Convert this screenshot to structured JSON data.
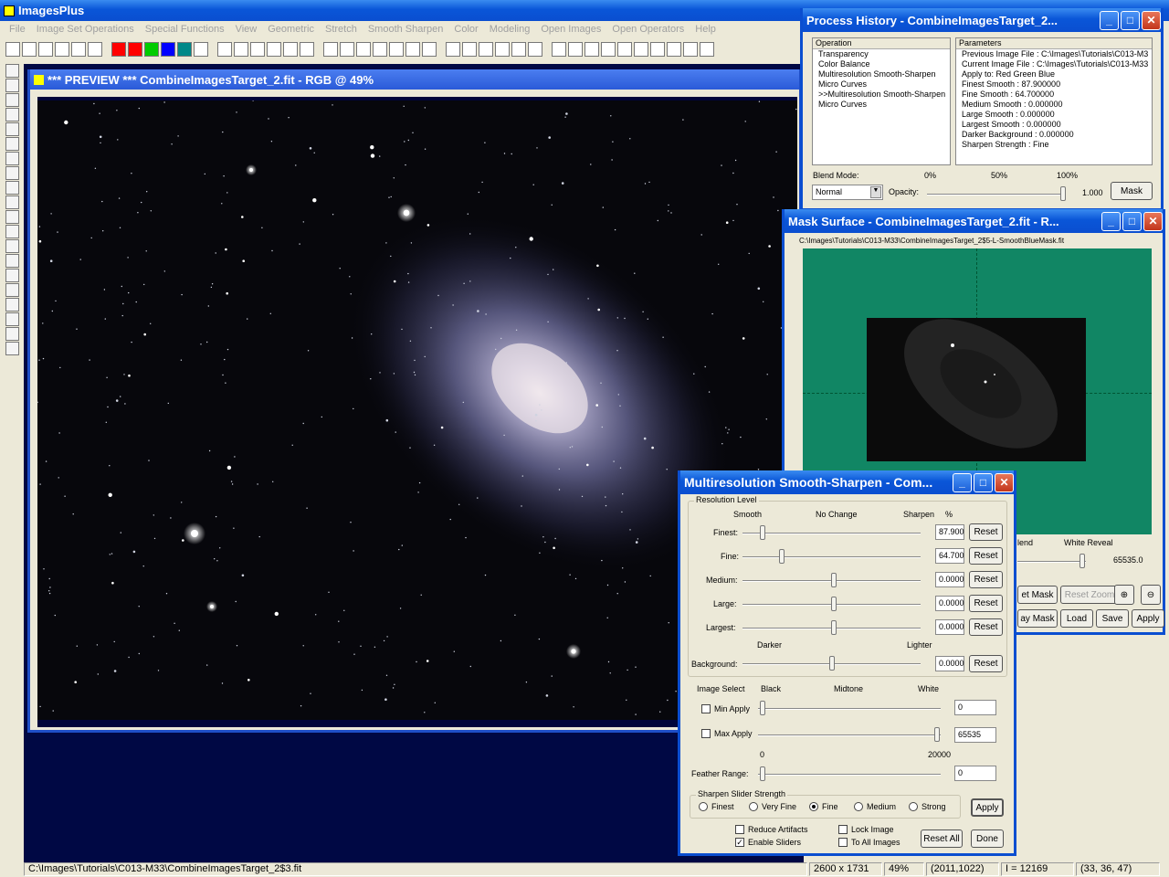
{
  "app": {
    "title": "ImagesPlus",
    "menu": [
      "File",
      "Image Set Operations",
      "Special Functions",
      "View",
      "Geometric",
      "Stretch",
      "Smooth Sharpen",
      "Color",
      "Modeling",
      "Open Images",
      "Open Operators",
      "Help"
    ]
  },
  "preview": {
    "title": "*** PREVIEW *** CombineImagesTarget_2.fit - RGB @  49%"
  },
  "history": {
    "title": "Process History - CombineImagesTarget_2...",
    "op_header": "Operation",
    "param_header": "Parameters",
    "operations": [
      "Transparency",
      "Color Balance",
      "Multiresolution Smooth-Sharpen",
      "Micro Curves",
      ">>Multiresolution Smooth-Sharpen",
      "Micro Curves"
    ],
    "parameters": [
      "Previous Image File : C:\\Images\\Tutorials\\C013-M3",
      "Current Image File : C:\\Images\\Tutorials\\C013-M33",
      "Apply to:  Red Green Blue",
      "Finest Smooth : 87.900000",
      "Fine Smooth : 64.700000",
      "Medium Smooth : 0.000000",
      "Large Smooth : 0.000000",
      "Largest Smooth : 0.000000",
      "Darker Background : 0.000000",
      "Sharpen Strength : Fine"
    ],
    "blend_label": "Blend Mode:",
    "blend_value": "Normal",
    "opacity_label": "Opacity:",
    "pct0": "0%",
    "pct50": "50%",
    "pct100": "100%",
    "opacity_value": "1.000",
    "mask_btn": "Mask"
  },
  "mask": {
    "title": "Mask Surface - CombineImagesTarget_2.fit - R...",
    "path": "C:\\Images\\Tutorials\\C013-M33\\CombineImagesTarget_2$5-L-SmoothBlueMask.fit",
    "blend_label": "lend",
    "white_reveal": "White Reveal",
    "reveal_value": "65535.0",
    "set_mask": "et Mask",
    "reset_zoom": "Reset Zoom",
    "ay_mask": "ay Mask",
    "load": "Load",
    "save": "Save",
    "apply": "Apply"
  },
  "mss": {
    "title": "Multiresolution Smooth-Sharpen - Com...",
    "resolution_level": "Resolution Level",
    "smooth": "Smooth",
    "no_change": "No Change",
    "sharpen": "Sharpen",
    "pct": "%",
    "rows": [
      {
        "label": "Finest:",
        "value": "87.900",
        "reset": "Reset"
      },
      {
        "label": "Fine:",
        "value": "64.700",
        "reset": "Reset"
      },
      {
        "label": "Medium:",
        "value": "0.0000",
        "reset": "Reset"
      },
      {
        "label": "Large:",
        "value": "0.0000",
        "reset": "Reset"
      },
      {
        "label": "Largest:",
        "value": "0.0000",
        "reset": "Reset"
      }
    ],
    "darker": "Darker",
    "lighter": "Lighter",
    "background_label": "Background:",
    "background_value": "0.0000",
    "background_reset": "Reset",
    "image_select": "Image Select",
    "black": "Black",
    "midtone": "Midtone",
    "white": "White",
    "min_apply": "Min Apply",
    "min_value": "0",
    "max_apply": "Max Apply",
    "max_value": "65535",
    "range_low": "0",
    "range_high": "20000",
    "feather": "Feather Range:",
    "feather_value": "0",
    "strength_title": "Sharpen Slider Strength",
    "strengths": [
      "Finest",
      "Very Fine",
      "Fine",
      "Medium",
      "Strong"
    ],
    "strength_selected": "Fine",
    "apply": "Apply",
    "reduce": "Reduce Artifacts",
    "enable": "Enable Sliders",
    "lock": "Lock Image",
    "to_all": "To All Images",
    "reset_all": "Reset All",
    "done": "Done"
  },
  "status": {
    "path": "C:\\Images\\Tutorials\\C013-M33\\CombineImagesTarget_2$3.fit",
    "size": "2600 x 1731",
    "zoom": "49%",
    "coord": "(2011,1022)",
    "intensity": "I = 12169",
    "rgb": "(33, 36, 47)"
  }
}
